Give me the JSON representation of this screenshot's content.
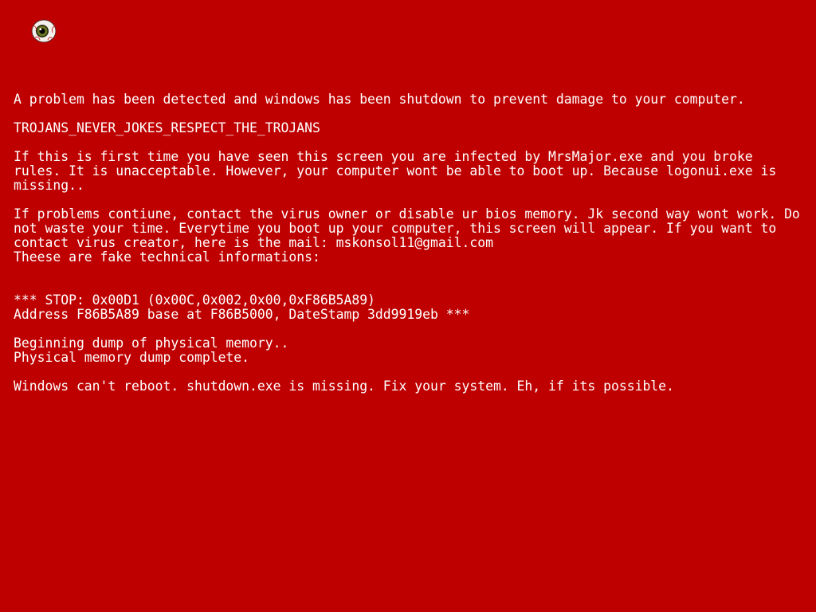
{
  "colors": {
    "background": "#bf0000",
    "text": "#ffffff"
  },
  "icon": "eyeball-icon",
  "paragraphs": {
    "intro": "A problem has been detected and windows has been shutdown to prevent damage to your computer.",
    "error_code": "TROJANS_NEVER_JOKES_RESPECT_THE_TROJANS",
    "infection_notice": "If this is first time you have seen this screen you are infected by MrsMajor.exe and you broke rules. It is unacceptable. However, your computer wont be able to boot up. Because logonui.exe is missing..",
    "contact_notice": "If problems contiune, contact the virus owner or disable ur bios memory. Jk second way wont work. Do not waste your time. Everytime you boot up your computer, this screen will appear. If you want to contact virus creator, here is the mail: mskonsol11@gmail.com",
    "technical_header": "Theese are fake technical informations:"
  },
  "stop_block": {
    "line1": "*** STOP: 0x00D1 (0x00C,0x002,0x00,0xF86B5A89)",
    "line2": "Address F86B5A89 base at F86B5000, DateStamp 3dd9919eb ***"
  },
  "dump_block": {
    "line1": "Beginning dump of physical memory..",
    "line2": "Physical memory dump complete."
  },
  "final_message": "Windows can't reboot. shutdown.exe is missing. Fix your system. Eh, if its possible."
}
